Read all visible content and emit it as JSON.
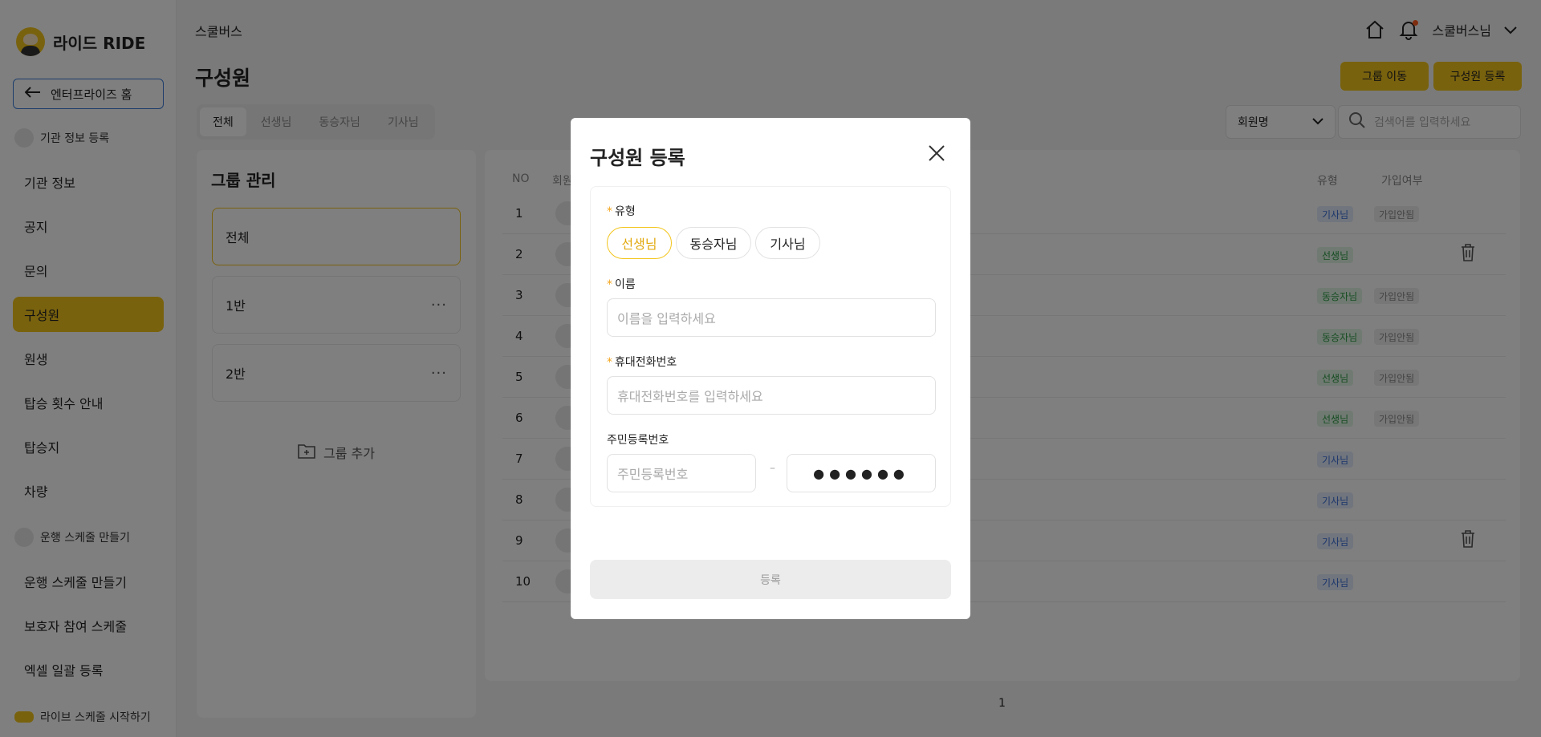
{
  "brand": {
    "name": "라이드 RIDE",
    "accent": "#f3c51c"
  },
  "sidebar": {
    "enterprise_button": "엔터프라이즈 홈",
    "sections": [
      {
        "label": "기관 정보 등록",
        "icon": "org-icon"
      },
      {
        "label": "운행 스케줄 만들기",
        "icon": "schedule-icon"
      },
      {
        "label": "라이브 스케줄 시작하기",
        "icon": "live-icon"
      }
    ],
    "items": [
      {
        "label": "기관 정보"
      },
      {
        "label": "공지"
      },
      {
        "label": "문의"
      },
      {
        "label": "구성원",
        "active": true
      },
      {
        "label": "원생"
      },
      {
        "label": "탑승 횟수 안내"
      },
      {
        "label": "탑승지"
      },
      {
        "label": "차량"
      },
      {
        "label": "운행 스케줄 만들기"
      },
      {
        "label": "보호자 참여 스케줄"
      },
      {
        "label": "엑셀 일괄 등록"
      }
    ]
  },
  "header": {
    "breadcrumb": "스쿨버스",
    "user": "스쿨버스님",
    "title": "구성원",
    "move_group_button": "그룹 이동",
    "register_member_button": "구성원 등록"
  },
  "tabs": [
    "전체",
    "선생님",
    "동승자님",
    "기사님"
  ],
  "filter": {
    "select_value": "회원명",
    "search_placeholder": "검색어를 입력하세요"
  },
  "groups": {
    "title": "그룹 관리",
    "items": [
      "전체",
      "1반",
      "2반"
    ],
    "add_label": "그룹 추가"
  },
  "table": {
    "headers": {
      "no": "NO",
      "member": "회원",
      "type": "유형",
      "joined": "가입여부"
    },
    "rows": [
      {
        "no": "1",
        "type": "기사님",
        "type_kind": "driver",
        "status": "가입안됨"
      },
      {
        "no": "2",
        "type": "선생님",
        "type_kind": "teacher",
        "status": ""
      },
      {
        "no": "3",
        "type": "동승자님",
        "type_kind": "rider",
        "status": "가입안됨"
      },
      {
        "no": "4",
        "type": "동승자님",
        "type_kind": "rider",
        "status": "가입안됨"
      },
      {
        "no": "5",
        "type": "선생님",
        "type_kind": "teacher",
        "status": "가입안됨"
      },
      {
        "no": "6",
        "type": "선생님",
        "type_kind": "teacher",
        "status": "가입안됨"
      },
      {
        "no": "7",
        "type": "기사님",
        "type_kind": "driver",
        "status": ""
      },
      {
        "no": "8",
        "type": "기사님",
        "type_kind": "driver",
        "status": ""
      },
      {
        "no": "9",
        "type": "기사님",
        "type_kind": "driver",
        "status": ""
      },
      {
        "no": "10",
        "type": "기사님",
        "type_kind": "driver",
        "status": ""
      }
    ],
    "page": "1"
  },
  "modal": {
    "title": "구성원 등록",
    "type_label": "유형",
    "types": [
      "선생님",
      "동승자님",
      "기사님"
    ],
    "selected_type": "선생님",
    "name_label": "이름",
    "name_placeholder": "이름을 입력하세요",
    "phone_label": "휴대전화번호",
    "phone_placeholder": "휴대전화번호를 입력하세요",
    "rrn_label": "주민등록번호",
    "rrn_front_placeholder": "주민등록번호",
    "rrn_dash": "–",
    "rrn_back_masked": "●●●●●●",
    "submit_label": "등록"
  }
}
